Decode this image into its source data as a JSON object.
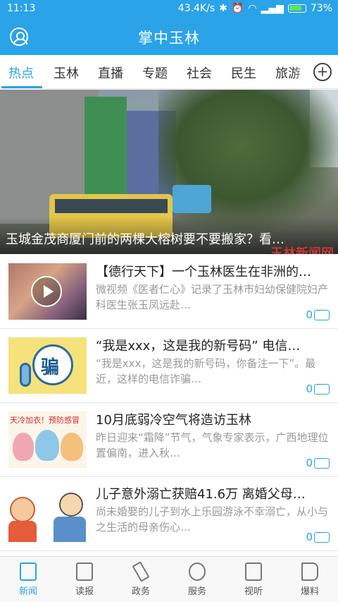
{
  "status_bar": {
    "time": "11:13",
    "network_speed": "43.4K/s",
    "battery": "73%"
  },
  "app_bar": {
    "title": "掌中玉林"
  },
  "tabs": [
    {
      "label": "热点"
    },
    {
      "label": "玉林"
    },
    {
      "label": "直播"
    },
    {
      "label": "专题"
    },
    {
      "label": "社会"
    },
    {
      "label": "民生"
    },
    {
      "label": "旅游"
    }
  ],
  "add_tab_label": "+",
  "hero": {
    "caption": "玉城金茂商厦门前的两棵大榕树要不要搬家？看…",
    "watermark": "玉林新闻网"
  },
  "news": [
    {
      "title": "【德行天下】一个玉林医生在非洲的…",
      "summary": "微视频《医者仁心》记录了玉林市妇幼保健院妇产科医生张玉凤远赴…",
      "comments": "0"
    },
    {
      "title": "“我是xxx，这是我的新号码” 电信…",
      "summary": "“我是xxx，这是我的新号码，你备注一下”。最近，这样的电信诈骗…",
      "comments": "0",
      "thumb_text": "骗"
    },
    {
      "title": "10月底弱冷空气将造访玉林",
      "summary": "昨日迎来“霜降”节气，气象专家表示，广西地理位置偏南，进入秋…",
      "comments": "0",
      "thumb_text": "天冷加衣！预防感冒"
    },
    {
      "title": "儿子意外溺亡获赔41.6万 离婚父母…",
      "summary": "尚未婚娶的儿子到水上乐园游泳不幸溺亡，从小与之生活的母亲伤心…",
      "comments": "0"
    }
  ],
  "bottom_nav": [
    {
      "label": "新闻"
    },
    {
      "label": "读报"
    },
    {
      "label": "政务"
    },
    {
      "label": "服务"
    },
    {
      "label": "视听"
    },
    {
      "label": "爆料"
    }
  ],
  "colors": {
    "accent": "#2aa3e8"
  }
}
